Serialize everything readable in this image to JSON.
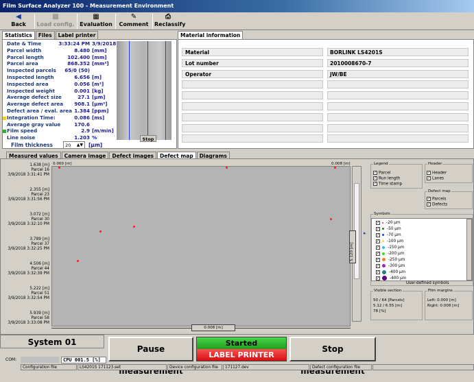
{
  "app": {
    "title": "Film Surface Analyzer 100 - Measurement Environment"
  },
  "toolbar": {
    "back": "Back",
    "load_config": "Load config.",
    "evaluation": "Evaluation",
    "comment": "Comment",
    "reclassify": "Reclassify"
  },
  "tabs_top": [
    "Statistics",
    "Files",
    "Label printer"
  ],
  "material_tab": "Material information",
  "statistics": [
    {
      "label": "Date & Time",
      "value": "3:33:24 PM",
      "unit": "3/9/2018"
    },
    {
      "label": "Parcel width",
      "value": "8.480",
      "unit": "[mm]"
    },
    {
      "label": "Parcel length",
      "value": "102.400",
      "unit": "[mm]"
    },
    {
      "label": "Parcel area",
      "value": "868.352",
      "unit": "[mm²]"
    },
    {
      "label": "Inspected parcels",
      "value": "65/0 (50)",
      "unit": ""
    },
    {
      "label": "Inspected length",
      "value": "6.656",
      "unit": "[m]"
    },
    {
      "label": "Inspected area",
      "value": "0.056",
      "unit": "[m²]"
    },
    {
      "label": "Inspected weight",
      "value": "0.001",
      "unit": "[kg]"
    },
    {
      "label": "Average defect size",
      "value": "27.1",
      "unit": "[µm]"
    },
    {
      "label": "Average defect area",
      "value": "908.1",
      "unit": "[µm²]"
    },
    {
      "label": "Defect area / eval. area",
      "value": "1.384",
      "unit": "[ppm]"
    },
    {
      "label": "Integration Time:",
      "value": "0.086",
      "unit": "[ms]"
    },
    {
      "label": "Average gray value",
      "value": "170.6",
      "unit": ""
    },
    {
      "label": "Film speed",
      "value": "2.9",
      "unit": "[m/min]"
    },
    {
      "label": "Line noise",
      "value": "1.203",
      "unit": "%"
    }
  ],
  "stop_label": "Stop",
  "film_thickness": {
    "label": "Film thickness",
    "value": "20",
    "unit": "[µm]"
  },
  "material": [
    {
      "label": "Material",
      "value": "BORLINK LS4201S"
    },
    {
      "label": "Lot number",
      "value": "2010008670-7"
    },
    {
      "label": "Operator",
      "value": "JW/BE"
    },
    {
      "label": "",
      "value": ""
    },
    {
      "label": "",
      "value": ""
    },
    {
      "label": "",
      "value": ""
    },
    {
      "label": "",
      "value": ""
    },
    {
      "label": "",
      "value": ""
    },
    {
      "label": "",
      "value": ""
    }
  ],
  "tabs_bottom": [
    "Measured values",
    "Camera image",
    "Defect images",
    "Defect map",
    "Diagrams"
  ],
  "defect_map": {
    "x_left": "0.000 [m]",
    "x_right": "0.008 [m]",
    "width_label": "0.008 [m]",
    "height_label": "5.120 [m]",
    "rows": [
      {
        "pos": "1.638 [m]",
        "parcel": "Parcel 16",
        "time": "3/9/2018 3:31:41 PM"
      },
      {
        "pos": "2.355 [m]",
        "parcel": "Parcel 23",
        "time": "3/9/2018 3:31:56 PM"
      },
      {
        "pos": "3.072 [m]",
        "parcel": "Parcel 30",
        "time": "3/9/2018 3:32:10 PM"
      },
      {
        "pos": "3.789 [m]",
        "parcel": "Parcel 37",
        "time": "3/9/2018 3:32:25 PM"
      },
      {
        "pos": "4.506 [m]",
        "parcel": "Parcel 44",
        "time": "3/9/2018 3:32:39 PM"
      },
      {
        "pos": "5.222 [m]",
        "parcel": "Parcel 51",
        "time": "3/9/2018 3:32:54 PM"
      },
      {
        "pos": "5.939 [m]",
        "parcel": "Parcel 58",
        "time": "3/9/2018 3:33:08 PM"
      }
    ],
    "defects": [
      {
        "x": 0.0002,
        "y": 1.67
      },
      {
        "x": 0.0047,
        "y": 1.67
      },
      {
        "x": 0.0076,
        "y": 1.66
      },
      {
        "x": 0.0075,
        "y": 3.32
      },
      {
        "x": 0.0022,
        "y": 3.56
      },
      {
        "x": 0.0013,
        "y": 3.72
      },
      {
        "x": 0.0007,
        "y": 4.68
      }
    ]
  },
  "legend": {
    "title": "Legend",
    "items": [
      "Parcel",
      "Run length",
      "Time stamp"
    ]
  },
  "header": {
    "title": "Header",
    "items": [
      "Header",
      "Lanes"
    ]
  },
  "defectmap_opts": {
    "title": "Defect map",
    "items": [
      "Parcels",
      "Defects"
    ]
  },
  "symbols": {
    "title": "Symbols",
    "footer": "User-defined symbols",
    "items": [
      {
        "label": "-20 µm",
        "color": "#ff2020",
        "size": 2
      },
      {
        "label": "-50 µm",
        "color": "#208020",
        "size": 3
      },
      {
        "label": "-70 µm",
        "color": "#2030ff",
        "size": 3
      },
      {
        "label": "-100 µm",
        "color": "#ffe020",
        "size": 3
      },
      {
        "label": "-150 µm",
        "color": "#20c0ff",
        "size": 4
      },
      {
        "label": "-200 µm",
        "color": "#40e020",
        "size": 4
      },
      {
        "label": "-250 µm",
        "color": "#ff8020",
        "size": 5
      },
      {
        "label": "-300 µm",
        "color": "#a020c0",
        "size": 5
      },
      {
        "label": "-400 µm",
        "color": "#208080",
        "size": 6
      },
      {
        "label": "-400 µm",
        "color": "#600080",
        "size": 7
      }
    ]
  },
  "visible_section": {
    "title": "Visible section",
    "lines": [
      "50 / 64 [Parcels]",
      "5.12 / 6.55 [m]",
      "78 [%]"
    ]
  },
  "film_margins": {
    "title": "Film margins",
    "lines": [
      "Left: 0.000 [m]",
      "Right: 0.008 [m]"
    ]
  },
  "system": "System 01",
  "buttons": {
    "pause": "Pause measurement",
    "started": "Started",
    "label_printer": "LABEL PRINTER",
    "stop": "Stop measurement"
  },
  "com": {
    "label": "COM:",
    "cpu": "CPU 001.5 [%]"
  },
  "statusbar": [
    {
      "label": "Configuration file",
      "value": "LS4201S 171123.set"
    },
    {
      "label": "Device configuration file",
      "value": "171127.dev"
    },
    {
      "label": "Defect configuration file",
      "value": ""
    }
  ]
}
